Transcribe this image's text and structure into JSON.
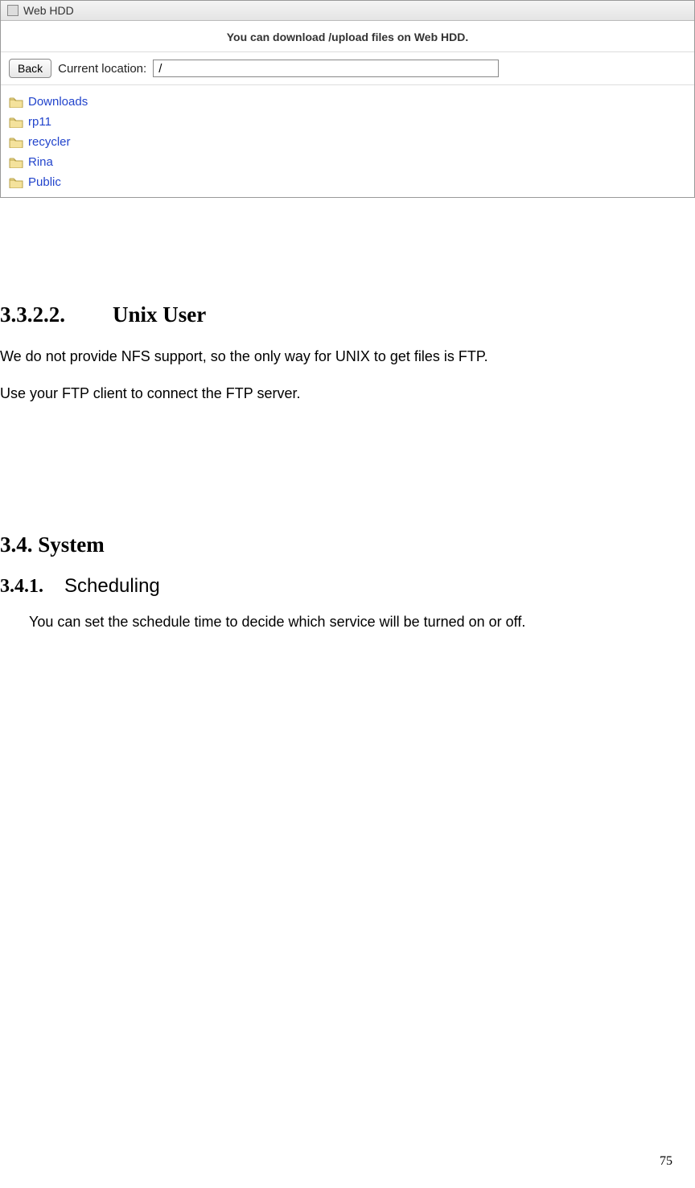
{
  "webhdd": {
    "title": "Web HDD",
    "info": "You can download /upload files on Web HDD.",
    "back_label": "Back",
    "location_label": "Current location:",
    "location_value": "/",
    "items": [
      {
        "name": "Downloads"
      },
      {
        "name": "rp11"
      },
      {
        "name": "recycler"
      },
      {
        "name": "Rina"
      },
      {
        "name": "Public"
      }
    ]
  },
  "sections": {
    "unix_user": {
      "number": "3.3.2.2.",
      "title": "Unix User",
      "para1": "We do not provide NFS support, so the only way for UNIX to get files is FTP.",
      "para2": "Use your FTP client to connect the FTP server."
    },
    "system": {
      "number_title": "3.4. System"
    },
    "scheduling": {
      "number": "3.4.1.",
      "title": "Scheduling",
      "para": "You can set the schedule time to decide which service will be turned on or off."
    }
  },
  "page_number": "75"
}
